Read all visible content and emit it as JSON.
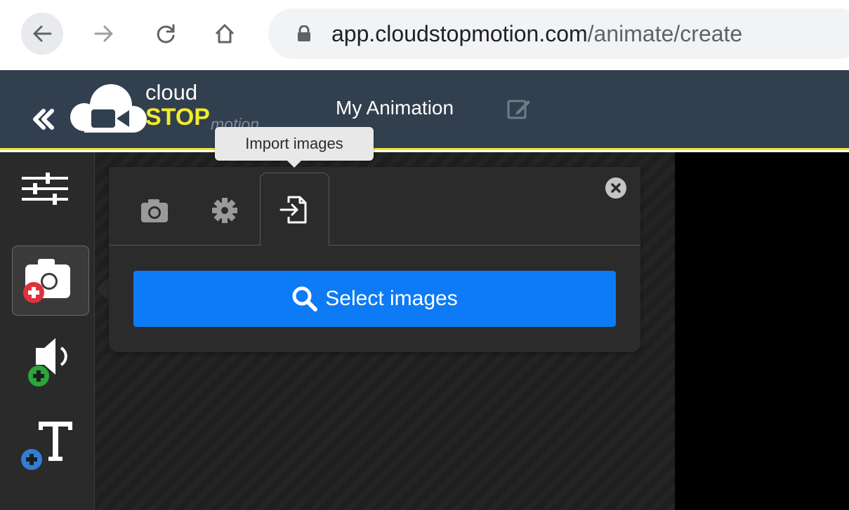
{
  "browser": {
    "url_host": "app.cloudstopmotion.com",
    "url_path": "/animate/create",
    "icons": [
      "back-arrow-icon",
      "forward-arrow-icon",
      "reload-icon",
      "home-icon",
      "lock-icon"
    ]
  },
  "app": {
    "logo": {
      "line1": "cloud",
      "line2": "STOP",
      "line3": "motion"
    },
    "project_title": "My Animation",
    "colors": {
      "header_bg": "#323f4e",
      "accent_yellow": "#ece52b",
      "primary_button": "#0d7af6",
      "add_red": "#e0323c",
      "add_green": "#2aa63a",
      "add_blue": "#2f7fd6"
    }
  },
  "sidebar": {
    "items": [
      {
        "name": "settings-sliders",
        "icon": "sliders-icon"
      },
      {
        "name": "add-camera",
        "icon": "camera-add-icon",
        "active": true
      },
      {
        "name": "add-audio",
        "icon": "audio-add-icon"
      },
      {
        "name": "add-text",
        "icon": "text-add-icon"
      }
    ]
  },
  "import_panel": {
    "tabs": [
      {
        "name": "camera",
        "icon": "camera-icon"
      },
      {
        "name": "settings",
        "icon": "gear-icon"
      },
      {
        "name": "import",
        "icon": "file-import-icon",
        "active": true
      }
    ],
    "tooltip": "Import images",
    "select_button_label": "Select images"
  }
}
